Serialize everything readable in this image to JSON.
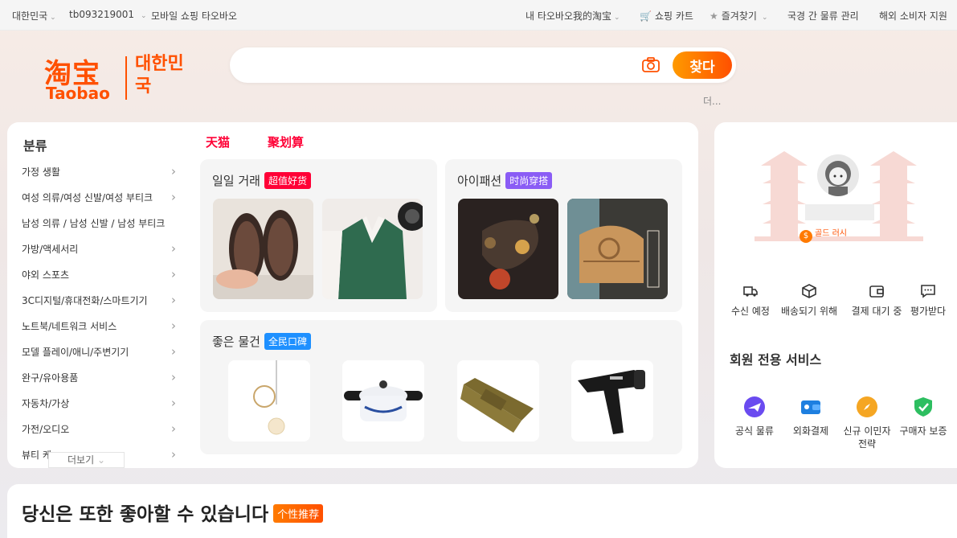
{
  "topbar": {
    "region": "대한민국",
    "username": "tb093219001",
    "mobile": "모바일 쇼핑 타오바오",
    "my_taobao": "내 타오바오我的淘宝",
    "cart": "쇼핑 카트",
    "favorites": "즐겨찾기",
    "logistics": "국경 간 물류 관리",
    "overseas_support": "해외 소비자 지원"
  },
  "logo": {
    "cn": "淘宝",
    "en": "Taobao",
    "region": "대한민국"
  },
  "search": {
    "placeholder": "",
    "button": "찾다",
    "more": "더..."
  },
  "categories": {
    "title": "분류",
    "items": [
      {
        "label": "가정 생활",
        "chevron": true
      },
      {
        "label": "여성 의류/여성 신발/여성 부티크",
        "chevron": true
      },
      {
        "label": "남성 의류 / 남성 신발 / 남성 부티크",
        "chevron": false
      },
      {
        "label": "가방/액세서리",
        "chevron": true
      },
      {
        "label": "야외 스포츠",
        "chevron": true
      },
      {
        "label": "3C디지털/휴대전화/스마트기기",
        "chevron": true
      },
      {
        "label": "노트북/네트워크 서비스",
        "chevron": true
      },
      {
        "label": "모델 플레이/애니/주변기기",
        "chevron": true
      },
      {
        "label": "완구/유아용품",
        "chevron": true
      },
      {
        "label": "자동차/가상",
        "chevron": true
      },
      {
        "label": "가전/오디오",
        "chevron": true
      },
      {
        "label": "뷰티 케",
        "chevron": true
      }
    ],
    "more": "더보기"
  },
  "brand_tabs": [
    "天猫",
    "聚划算"
  ],
  "panels": {
    "deal": {
      "title": "일일 거래",
      "badge": "超值好货",
      "badge_color": "#ff0036"
    },
    "fashion": {
      "title": "아이패션",
      "badge": "时尚穿搭",
      "badge_color": "#8a5cf5"
    },
    "good": {
      "title": "좋은 물건",
      "badge": "全民口碑",
      "badge_color": "#1e90ff"
    }
  },
  "user": {
    "gold": "골드 러시",
    "orders": [
      "수신 예정",
      "배송되기 위해",
      "결제 대기 중",
      "평가받다"
    ],
    "services_title": "회원 전용 서비스",
    "services": [
      "공식 물류",
      "외화결제",
      "신규 이민자 전략",
      "구매자 보증"
    ]
  },
  "recommend": {
    "title": "당신은 또한 좋아할 수 있습니다",
    "badge": "个性推荐"
  },
  "colors": {
    "brand": "#ff5000",
    "tmall": "#ff0036"
  }
}
